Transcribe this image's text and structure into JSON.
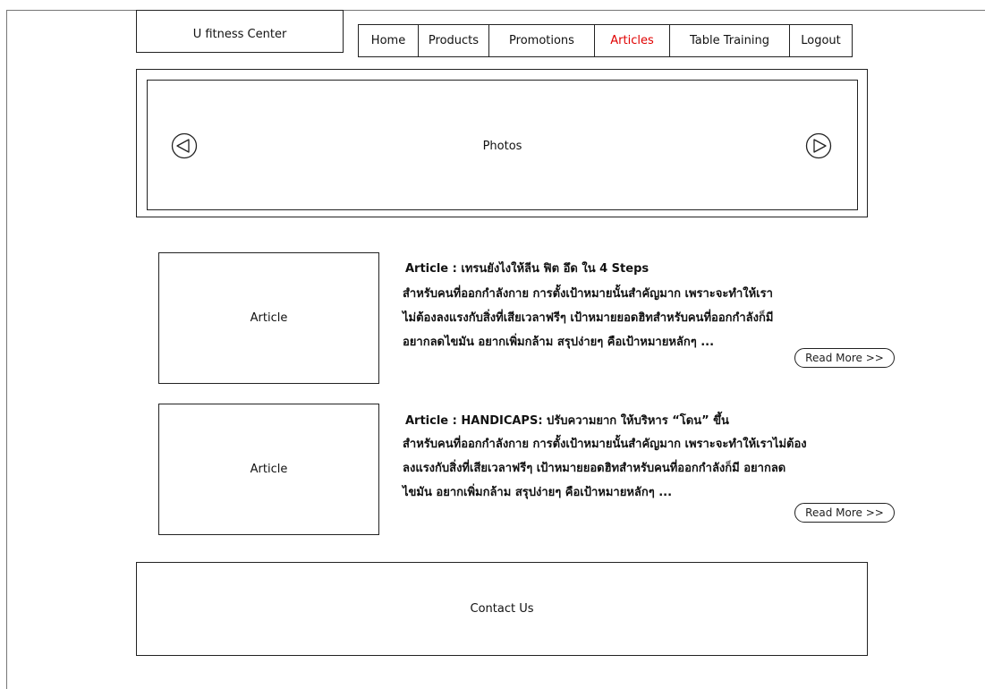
{
  "header": {
    "logo_text": "U fitness Center"
  },
  "nav": {
    "items": [
      {
        "label": "Home"
      },
      {
        "label": "Products"
      },
      {
        "label": "Promotions"
      },
      {
        "label": "Articles",
        "active": true
      },
      {
        "label": "Table Training"
      },
      {
        "label": "Logout"
      }
    ],
    "active_color": "#e00000"
  },
  "slider": {
    "label": "Photos",
    "prev_icon": "triangle-left-icon",
    "next_icon": "triangle-right-icon"
  },
  "articles": [
    {
      "image_label": "Article",
      "title": "Article : เทรนยังไงให้ลีน ฟิต อึด ใน 4 Steps",
      "lines": [
        "สำหรับคนที่ออกกำลังกาย การตั้งเป้าหมายนั้นสำคัญมาก เพราะจะทำให้เรา",
        "ไม่ต้องลงแรงกับสิ่งที่เสียเวลาฟรีๆ เป้าหมายยอดฮิทสำหรับคนที่ออกกำลังก็มี",
        "อยากลดไขมัน อยากเพิ่มกล้าม สรุปง่ายๆ คือเป้าหมายหลักๆ ..."
      ],
      "read_more": "Read More >>"
    },
    {
      "image_label": "Article",
      "title": "Article : HANDICAPS: ปรับความยาก ให้บริหาร “โดน” ขึ้น",
      "lines": [
        "สำหรับคนที่ออกกำลังกาย การตั้งเป้าหมายนั้นสำคัญมาก เพราะจะทำให้เราไม่ต้อง",
        "ลงแรงกับสิ่งที่เสียเวลาฟรีๆ เป้าหมายยอดฮิทสำหรับคนที่ออกกำลังก็มี อยากลด",
        "ไขมัน อยากเพิ่มกล้าม สรุปง่ายๆ คือเป้าหมายหลักๆ ..."
      ],
      "read_more": "Read More >>"
    }
  ],
  "footer": {
    "contact_label": "Contact Us"
  }
}
